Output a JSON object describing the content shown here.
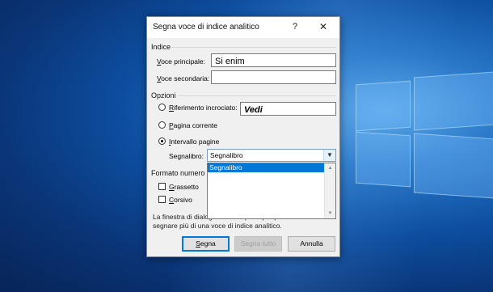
{
  "dialog": {
    "title": "Segna voce di indice analitico",
    "help_symbol": "?",
    "close_symbol": "✕"
  },
  "indice": {
    "section_label": "Indice",
    "main_entry": {
      "label_accel": "V",
      "label_rest": "oce principale:",
      "value": "Si enim"
    },
    "sub_entry": {
      "label_accel": "V",
      "label_rest": "oce secondaria:",
      "value": ""
    }
  },
  "opzioni": {
    "section_label": "Opzioni",
    "cross_ref": {
      "label_accel": "R",
      "label_rest": "iferimento incrociato:",
      "value": "Vedi",
      "selected": false
    },
    "current_page": {
      "label_accel": "P",
      "label_rest": "agina corrente",
      "selected": false
    },
    "page_range": {
      "label_accel": "I",
      "label_rest": "ntervallo pagine",
      "selected": true
    },
    "bookmark": {
      "label": "Segnalibro:",
      "value": "Segnalibro",
      "options": [
        "Segnalibro"
      ]
    }
  },
  "formato": {
    "section_label": "Formato numero d",
    "bold": {
      "label_accel": "G",
      "label_rest": "rassetto",
      "checked": false
    },
    "italic": {
      "label_accel": "C",
      "label_rest": "orsivo",
      "checked": false
    }
  },
  "note": "La finestra di dialogo rimane aperta per permettere di segnare più di una voce di indice analitico.",
  "buttons": {
    "mark": {
      "label_accel": "S",
      "label_rest": "egna"
    },
    "mark_all": {
      "label": "Segna tutto"
    },
    "cancel": {
      "label": "Annulla"
    }
  },
  "icons": {
    "combo_arrow": "chevron-down-icon",
    "scroll_up": "scroll-up-icon",
    "scroll_down": "scroll-down-icon"
  }
}
